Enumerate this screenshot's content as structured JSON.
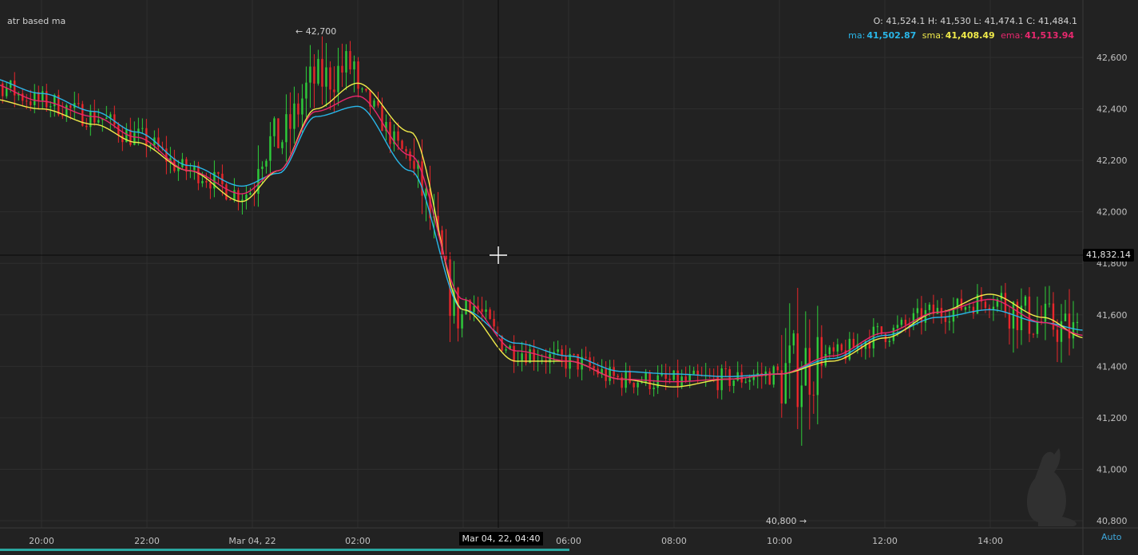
{
  "indicator_name": "atr based ma",
  "ohlc": {
    "o_label": "O:",
    "o": "41,524.1",
    "h_label": "H:",
    "h": "41,530",
    "l_label": "L:",
    "l": "41,474.1",
    "c_label": "C:",
    "c": "41,484.1"
  },
  "legend": [
    {
      "label": "ma:",
      "value": "41,502.87",
      "color": "#29b6e8"
    },
    {
      "label": "sma:",
      "value": "41,408.49",
      "color": "#f0ea4a"
    },
    {
      "label": "ema:",
      "value": "41,513.94",
      "color": "#e8286e"
    }
  ],
  "high_marker": "← 42,700",
  "low_marker": "40,800 →",
  "crosshair": {
    "time": "Mar 04, 22, 04:40",
    "price": "41,832.14"
  },
  "auto_label": "Auto",
  "colors": {
    "up": "#2ecc3a",
    "down": "#e8262a",
    "background": "#222222",
    "grid": "#2e2e2e"
  },
  "chart_data": {
    "type": "line",
    "y_axis": {
      "ticks": [
        "42,600",
        "42,400",
        "42,200",
        "42,000",
        "41,800",
        "41,600",
        "41,400",
        "41,200",
        "41,000",
        "40,800"
      ],
      "ylim": [
        40780,
        42800
      ],
      "scale": "linear"
    },
    "x_axis": {
      "ticks": [
        "20:00",
        "22:00",
        "Mar 04, 22",
        "02:00",
        "04:00",
        "06:00",
        "08:00",
        "10:00",
        "12:00",
        "14:00"
      ],
      "partially_hidden_tick": "04:00"
    },
    "grid": true,
    "candlestick_series": "green up / red down price bars (Mar 03 19:00 – Mar 04 15:40)",
    "series": [
      {
        "name": "ma",
        "color": "#29b6e8",
        "x_hours": [
          -5.8,
          -5,
          -4,
          -3,
          -2.2,
          -1.2,
          -0.2,
          0.5,
          1.2,
          2,
          3,
          4,
          5,
          6,
          7,
          8,
          9,
          10,
          11,
          12,
          13,
          14,
          15,
          15.8
        ],
        "values": [
          42640,
          42520,
          42460,
          42390,
          42310,
          42180,
          42100,
          42150,
          42370,
          42410,
          42160,
          41620,
          41490,
          41440,
          41380,
          41370,
          41360,
          41370,
          41430,
          41520,
          41590,
          41620,
          41570,
          41540
        ]
      },
      {
        "name": "sma",
        "color": "#f0ea4a",
        "x_hours": [
          -5.8,
          -5,
          -4,
          -3,
          -2.2,
          -1.2,
          -0.2,
          0.5,
          1.2,
          2,
          3,
          4,
          5,
          6,
          7,
          8,
          9,
          10,
          11,
          12,
          13,
          14,
          15,
          15.8
        ],
        "values": [
          42510,
          42440,
          42400,
          42340,
          42270,
          42160,
          42040,
          42160,
          42400,
          42500,
          42310,
          41620,
          41420,
          41420,
          41350,
          41320,
          41350,
          41370,
          41420,
          41510,
          41610,
          41680,
          41590,
          41510
        ]
      },
      {
        "name": "ema",
        "color": "#e8286e",
        "x_hours": [
          -5.8,
          -5,
          -4,
          -3,
          -2.2,
          -1.2,
          -0.2,
          0.5,
          1.2,
          2,
          3,
          4,
          5,
          6,
          7,
          8,
          9,
          10,
          11,
          12,
          13,
          14,
          15,
          15.8
        ],
        "values": [
          42580,
          42500,
          42430,
          42370,
          42290,
          42160,
          42070,
          42160,
          42390,
          42450,
          42220,
          41660,
          41460,
          41420,
          41350,
          41340,
          41350,
          41370,
          41440,
          41530,
          41610,
          41660,
          41570,
          41520
        ]
      }
    ]
  }
}
